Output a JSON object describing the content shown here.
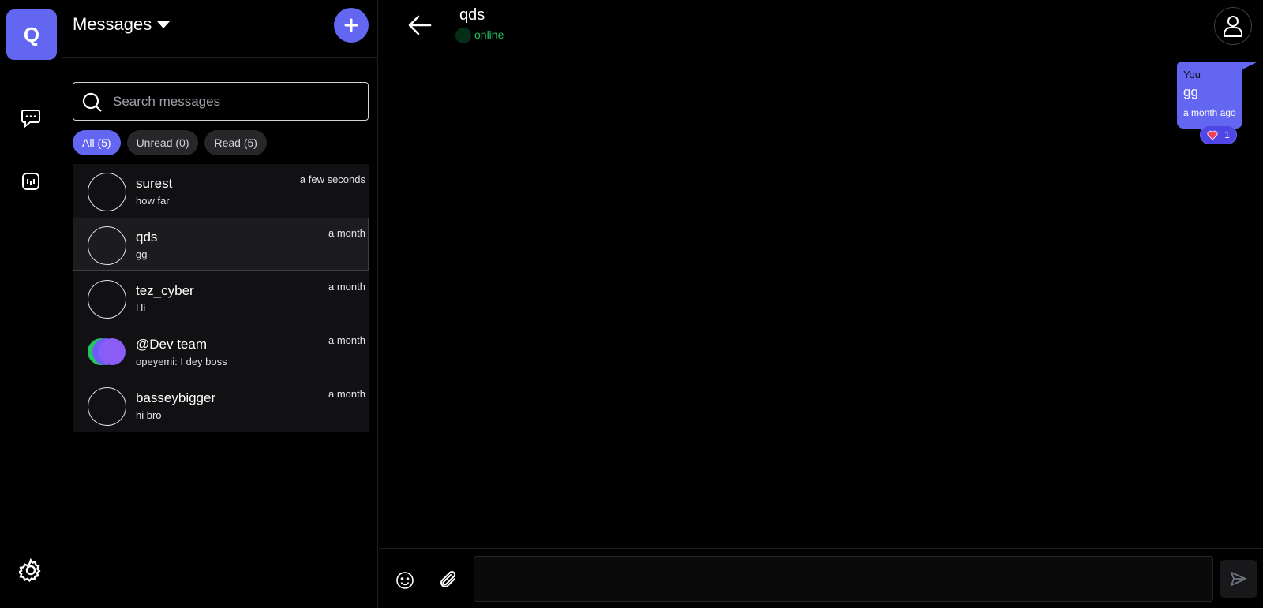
{
  "rail": {
    "logo_letter": "Q",
    "icons": [
      "chat-bubble-icon",
      "bot-icon",
      "settings-gear-icon"
    ]
  },
  "sidebar": {
    "title": "Messages",
    "search_placeholder": "Search messages",
    "filters": [
      {
        "label": "All (5)",
        "active": true
      },
      {
        "label": "Unread (0)",
        "active": false
      },
      {
        "label": "Read (5)",
        "active": false
      }
    ],
    "conversations": [
      {
        "name": "surest",
        "preview": "how far",
        "time": "a few seconds",
        "selected": false,
        "group": false
      },
      {
        "name": "qds",
        "preview": "gg",
        "time": "a month",
        "selected": true,
        "group": false
      },
      {
        "name": "tez_cyber",
        "preview": "Hi",
        "time": "a month",
        "selected": false,
        "group": false
      },
      {
        "name": "@Dev team",
        "preview": "opeyemi: I dey boss",
        "time": "a month",
        "selected": false,
        "group": true
      },
      {
        "name": "basseybigger",
        "preview": "hi bro",
        "time": "a month",
        "selected": false,
        "group": false
      }
    ]
  },
  "chat": {
    "name": "qds",
    "status": "online",
    "messages": [
      {
        "sender": "You",
        "text": "gg",
        "time": "a month ago",
        "reaction_count": "1"
      }
    ],
    "composer_placeholder": ""
  },
  "colors": {
    "accent": "#6366f1",
    "online": "#22c55e",
    "background": "#000000"
  }
}
